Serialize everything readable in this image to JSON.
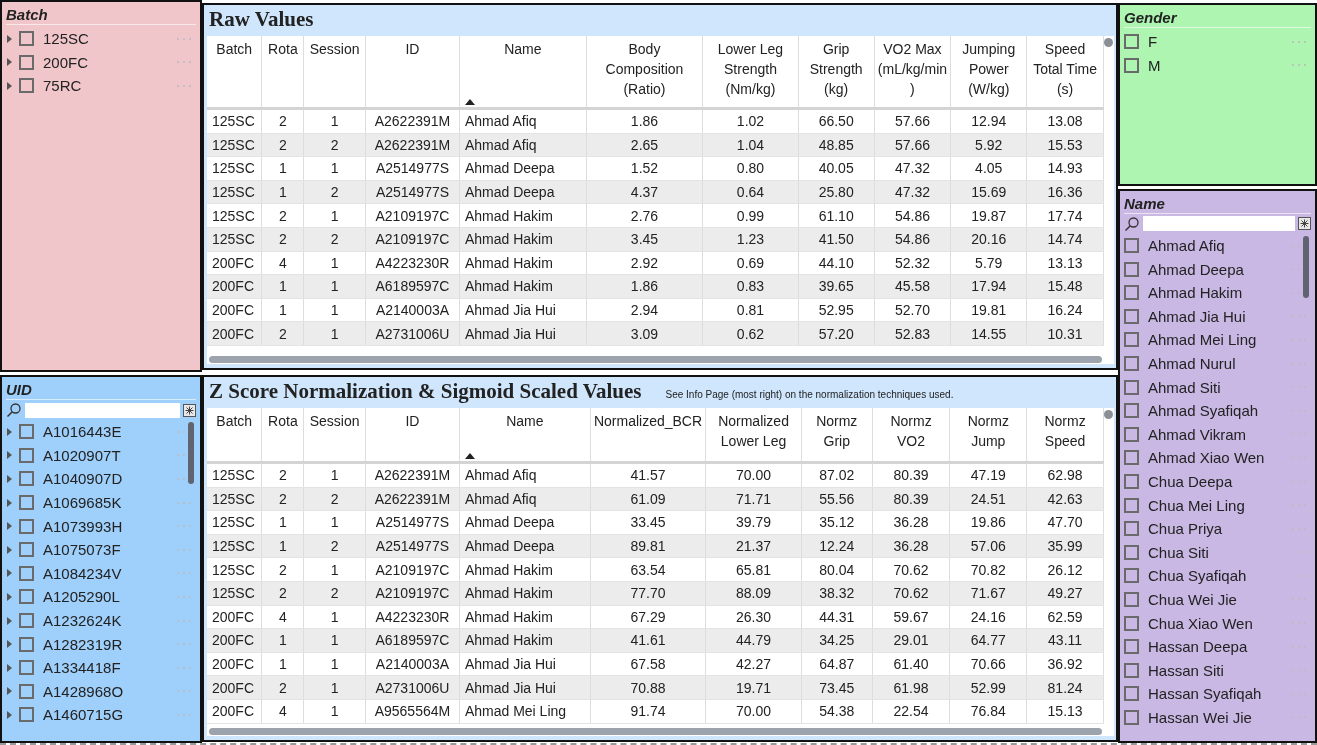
{
  "slicers_left": [
    {
      "title": "Batch",
      "color": "#f0c6ca",
      "searchable": false,
      "items": [
        {
          "label": "125SC",
          "checked": false,
          "expanded": false
        },
        {
          "label": "200FC",
          "checked": false,
          "expanded": false
        },
        {
          "label": "75RC",
          "checked": false,
          "expanded": false
        }
      ]
    },
    {
      "title": "UID",
      "color": "#9fd0fb",
      "searchable": true,
      "items": [
        {
          "label": "A1016443E",
          "checked": false,
          "expanded": false
        },
        {
          "label": "A1020907T",
          "checked": false,
          "expanded": false
        },
        {
          "label": "A1040907D",
          "checked": false,
          "expanded": false
        },
        {
          "label": "A1069685K",
          "checked": false,
          "expanded": false
        },
        {
          "label": "A1073993H",
          "checked": false,
          "expanded": false
        },
        {
          "label": "A1075073F",
          "checked": false,
          "expanded": false
        },
        {
          "label": "A1084234V",
          "checked": false,
          "expanded": false
        },
        {
          "label": "A1205290L",
          "checked": false,
          "expanded": false
        },
        {
          "label": "A1232624K",
          "checked": false,
          "expanded": false
        },
        {
          "label": "A1282319R",
          "checked": false,
          "expanded": false
        },
        {
          "label": "A1334418F",
          "checked": false,
          "expanded": false
        },
        {
          "label": "A1428968O",
          "checked": false,
          "expanded": false
        },
        {
          "label": "A1460715G",
          "checked": false,
          "expanded": false
        }
      ]
    }
  ],
  "tables": [
    {
      "title": "Raw Values",
      "columns": [
        {
          "label": "Batch",
          "sorted": false
        },
        {
          "label": "Rota",
          "sorted": false
        },
        {
          "label": "Session",
          "sorted": false
        },
        {
          "label": "ID",
          "sorted": false
        },
        {
          "label": "Name",
          "sorted": true
        },
        {
          "label": "Body Composition (Ratio)",
          "sorted": false
        },
        {
          "label": "Lower Leg Strength (Nm/kg)",
          "sorted": false
        },
        {
          "label": "Grip Strength (kg)",
          "sorted": false
        },
        {
          "label": "VO2 Max (mL/kg/min)",
          "sorted": false
        },
        {
          "label": "Jumping Power (W/kg)",
          "sorted": false
        },
        {
          "label": "Speed Total Time (s)",
          "sorted": false
        }
      ],
      "rows": [
        [
          "125SC",
          "2",
          "1",
          "A2622391M",
          "Ahmad Afiq",
          "1.86",
          "1.02",
          "66.50",
          "57.66",
          "12.94",
          "13.08"
        ],
        [
          "125SC",
          "2",
          "2",
          "A2622391M",
          "Ahmad Afiq",
          "2.65",
          "1.04",
          "48.85",
          "57.66",
          "5.92",
          "15.53"
        ],
        [
          "125SC",
          "1",
          "1",
          "A2514977S",
          "Ahmad Deepa",
          "1.52",
          "0.80",
          "40.05",
          "47.32",
          "4.05",
          "14.93"
        ],
        [
          "125SC",
          "1",
          "2",
          "A2514977S",
          "Ahmad Deepa",
          "4.37",
          "0.64",
          "25.80",
          "47.32",
          "15.69",
          "16.36"
        ],
        [
          "125SC",
          "2",
          "1",
          "A2109197C",
          "Ahmad Hakim",
          "2.76",
          "0.99",
          "61.10",
          "54.86",
          "19.87",
          "17.74"
        ],
        [
          "125SC",
          "2",
          "2",
          "A2109197C",
          "Ahmad Hakim",
          "3.45",
          "1.23",
          "41.50",
          "54.86",
          "20.16",
          "14.74"
        ],
        [
          "200FC",
          "4",
          "1",
          "A4223230R",
          "Ahmad Hakim",
          "2.92",
          "0.69",
          "44.10",
          "52.32",
          "5.79",
          "13.13"
        ],
        [
          "200FC",
          "1",
          "1",
          "A6189597C",
          "Ahmad Hakim",
          "1.86",
          "0.83",
          "39.65",
          "45.58",
          "17.94",
          "15.48"
        ],
        [
          "200FC",
          "1",
          "1",
          "A2140003A",
          "Ahmad Jia Hui",
          "2.94",
          "0.81",
          "52.95",
          "52.70",
          "19.81",
          "16.24"
        ],
        [
          "200FC",
          "2",
          "1",
          "A2731006U",
          "Ahmad Jia Hui",
          "3.09",
          "0.62",
          "57.20",
          "52.83",
          "14.55",
          "10.31"
        ]
      ]
    },
    {
      "title": "Z Score Normalization & Sigmoid Scaled Values",
      "note": "See Info Page (most right) on the normalization techniques used.",
      "columns": [
        {
          "label": "Batch",
          "sorted": false
        },
        {
          "label": "Rota",
          "sorted": false
        },
        {
          "label": "Session",
          "sorted": false
        },
        {
          "label": "ID",
          "sorted": false
        },
        {
          "label": "Name",
          "sorted": true
        },
        {
          "label": "Normalized_BCR",
          "sorted": false
        },
        {
          "label": "Normalized Lower Leg",
          "sorted": false
        },
        {
          "label": "Normz Grip",
          "sorted": false
        },
        {
          "label": "Normz VO2",
          "sorted": false
        },
        {
          "label": "Normz Jump",
          "sorted": false
        },
        {
          "label": "Normz Speed",
          "sorted": false
        }
      ],
      "rows": [
        [
          "125SC",
          "2",
          "1",
          "A2622391M",
          "Ahmad Afiq",
          "41.57",
          "70.00",
          "87.02",
          "80.39",
          "47.19",
          "62.98"
        ],
        [
          "125SC",
          "2",
          "2",
          "A2622391M",
          "Ahmad Afiq",
          "61.09",
          "71.71",
          "55.56",
          "80.39",
          "24.51",
          "42.63"
        ],
        [
          "125SC",
          "1",
          "1",
          "A2514977S",
          "Ahmad Deepa",
          "33.45",
          "39.79",
          "35.12",
          "36.28",
          "19.86",
          "47.70"
        ],
        [
          "125SC",
          "1",
          "2",
          "A2514977S",
          "Ahmad Deepa",
          "89.81",
          "21.37",
          "12.24",
          "36.28",
          "57.06",
          "35.99"
        ],
        [
          "125SC",
          "2",
          "1",
          "A2109197C",
          "Ahmad Hakim",
          "63.54",
          "65.81",
          "80.04",
          "70.62",
          "70.82",
          "26.12"
        ],
        [
          "125SC",
          "2",
          "2",
          "A2109197C",
          "Ahmad Hakim",
          "77.70",
          "88.09",
          "38.32",
          "70.62",
          "71.67",
          "49.27"
        ],
        [
          "200FC",
          "4",
          "1",
          "A4223230R",
          "Ahmad Hakim",
          "67.29",
          "26.30",
          "44.31",
          "59.67",
          "24.16",
          "62.59"
        ],
        [
          "200FC",
          "1",
          "1",
          "A6189597C",
          "Ahmad Hakim",
          "41.61",
          "44.79",
          "34.25",
          "29.01",
          "64.77",
          "43.11"
        ],
        [
          "200FC",
          "1",
          "1",
          "A2140003A",
          "Ahmad Jia Hui",
          "67.58",
          "42.27",
          "64.87",
          "61.40",
          "70.66",
          "36.92"
        ],
        [
          "200FC",
          "2",
          "1",
          "A2731006U",
          "Ahmad Jia Hui",
          "70.88",
          "19.71",
          "73.45",
          "61.98",
          "52.99",
          "81.24"
        ],
        [
          "200FC",
          "4",
          "1",
          "A9565564M",
          "Ahmad Mei Ling",
          "91.74",
          "70.00",
          "54.38",
          "22.54",
          "76.84",
          "15.13"
        ]
      ]
    }
  ],
  "slicers_right": [
    {
      "title": "Gender",
      "color": "#adf5b1",
      "searchable": false,
      "items": [
        {
          "label": "F",
          "checked": false
        },
        {
          "label": "M",
          "checked": false
        }
      ]
    },
    {
      "title": "Name",
      "color": "#c9b8e4",
      "searchable": true,
      "items": [
        {
          "label": "Ahmad Afiq",
          "checked": false
        },
        {
          "label": "Ahmad Deepa",
          "checked": false
        },
        {
          "label": "Ahmad Hakim",
          "checked": false
        },
        {
          "label": "Ahmad Jia Hui",
          "checked": false
        },
        {
          "label": "Ahmad Mei Ling",
          "checked": false
        },
        {
          "label": "Ahmad Nurul",
          "checked": false
        },
        {
          "label": "Ahmad Siti",
          "checked": false
        },
        {
          "label": "Ahmad Syafiqah",
          "checked": false
        },
        {
          "label": "Ahmad Vikram",
          "checked": false
        },
        {
          "label": "Ahmad Xiao Wen",
          "checked": false
        },
        {
          "label": "Chua Deepa",
          "checked": false
        },
        {
          "label": "Chua Mei Ling",
          "checked": false
        },
        {
          "label": "Chua Priya",
          "checked": false
        },
        {
          "label": "Chua Siti",
          "checked": false
        },
        {
          "label": "Chua Syafiqah",
          "checked": false
        },
        {
          "label": "Chua Wei Jie",
          "checked": false
        },
        {
          "label": "Chua Xiao Wen",
          "checked": false
        },
        {
          "label": "Hassan Deepa",
          "checked": false
        },
        {
          "label": "Hassan Siti",
          "checked": false
        },
        {
          "label": "Hassan Syafiqah",
          "checked": false
        },
        {
          "label": "Hassan Wei Jie",
          "checked": false
        }
      ]
    }
  ]
}
